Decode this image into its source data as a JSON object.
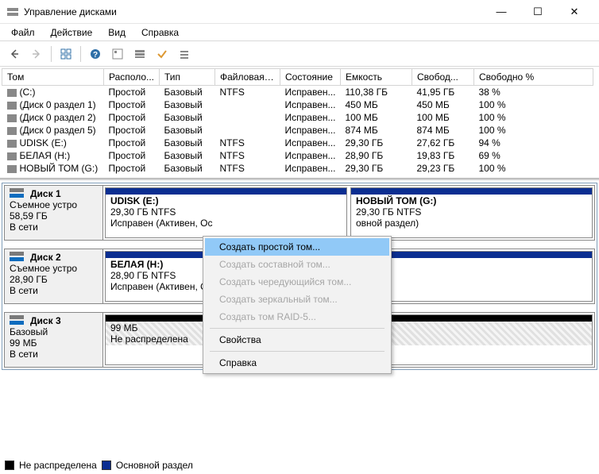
{
  "title": "Управление дисками",
  "menu": {
    "file": "Файл",
    "action": "Действие",
    "view": "Вид",
    "help": "Справка"
  },
  "columns": {
    "vol": "Том",
    "layout": "Располо...",
    "type": "Тип",
    "fs": "Файловая с...",
    "status": "Состояние",
    "capacity": "Емкость",
    "free": "Свобод...",
    "freepct": "Свободно %"
  },
  "volumes": [
    {
      "name": "(C:)",
      "layout": "Простой",
      "type": "Базовый",
      "fs": "NTFS",
      "status": "Исправен...",
      "cap": "110,38 ГБ",
      "free": "41,95 ГБ",
      "pct": "38 %"
    },
    {
      "name": "(Диск 0 раздел 1)",
      "layout": "Простой",
      "type": "Базовый",
      "fs": "",
      "status": "Исправен...",
      "cap": "450 МБ",
      "free": "450 МБ",
      "pct": "100 %"
    },
    {
      "name": "(Диск 0 раздел 2)",
      "layout": "Простой",
      "type": "Базовый",
      "fs": "",
      "status": "Исправен...",
      "cap": "100 МБ",
      "free": "100 МБ",
      "pct": "100 %"
    },
    {
      "name": "(Диск 0 раздел 5)",
      "layout": "Простой",
      "type": "Базовый",
      "fs": "",
      "status": "Исправен...",
      "cap": "874 МБ",
      "free": "874 МБ",
      "pct": "100 %"
    },
    {
      "name": "UDISK (E:)",
      "layout": "Простой",
      "type": "Базовый",
      "fs": "NTFS",
      "status": "Исправен...",
      "cap": "29,30 ГБ",
      "free": "27,62 ГБ",
      "pct": "94 %"
    },
    {
      "name": "БЕЛАЯ (H:)",
      "layout": "Простой",
      "type": "Базовый",
      "fs": "NTFS",
      "status": "Исправен...",
      "cap": "28,90 ГБ",
      "free": "19,83 ГБ",
      "pct": "69 %"
    },
    {
      "name": "НОВЫЙ ТОМ (G:)",
      "layout": "Простой",
      "type": "Базовый",
      "fs": "NTFS",
      "status": "Исправен...",
      "cap": "29,30 ГБ",
      "free": "29,23 ГБ",
      "pct": "100 %"
    }
  ],
  "disks": {
    "d1": {
      "name": "Диск 1",
      "l1": "Съемное устро",
      "l2": "58,59 ГБ",
      "l3": "В сети",
      "p1": {
        "title": "UDISK  (E:)",
        "sub": "29,30 ГБ NTFS",
        "st": "Исправен (Активен, Ос"
      },
      "p2": {
        "title": "НОВЫЙ ТОМ  (G:)",
        "sub": "29,30 ГБ NTFS",
        "st": "овной раздел)"
      }
    },
    "d2": {
      "name": "Диск 2",
      "l1": "Съемное устро",
      "l2": "28,90 ГБ",
      "l3": "В сети",
      "p1": {
        "title": "БЕЛАЯ  (H:)",
        "sub": "28,90 ГБ NTFS",
        "st": "Исправен (Активен, Ос"
      }
    },
    "d3": {
      "name": "Диск 3",
      "l1": "Базовый",
      "l2": "99 МБ",
      "l3": "В сети",
      "p1": {
        "title": "",
        "sub": "99 МБ",
        "st": "Не распределена"
      }
    }
  },
  "ctx": {
    "simple": "Создать простой том...",
    "spanned": "Создать составной том...",
    "striped": "Создать чередующийся том...",
    "mirror": "Создать зеркальный том...",
    "raid": "Создать том RAID-5...",
    "props": "Свойства",
    "help": "Справка"
  },
  "legend": {
    "unalloc": "Не распределена",
    "primary": "Основной раздел"
  }
}
